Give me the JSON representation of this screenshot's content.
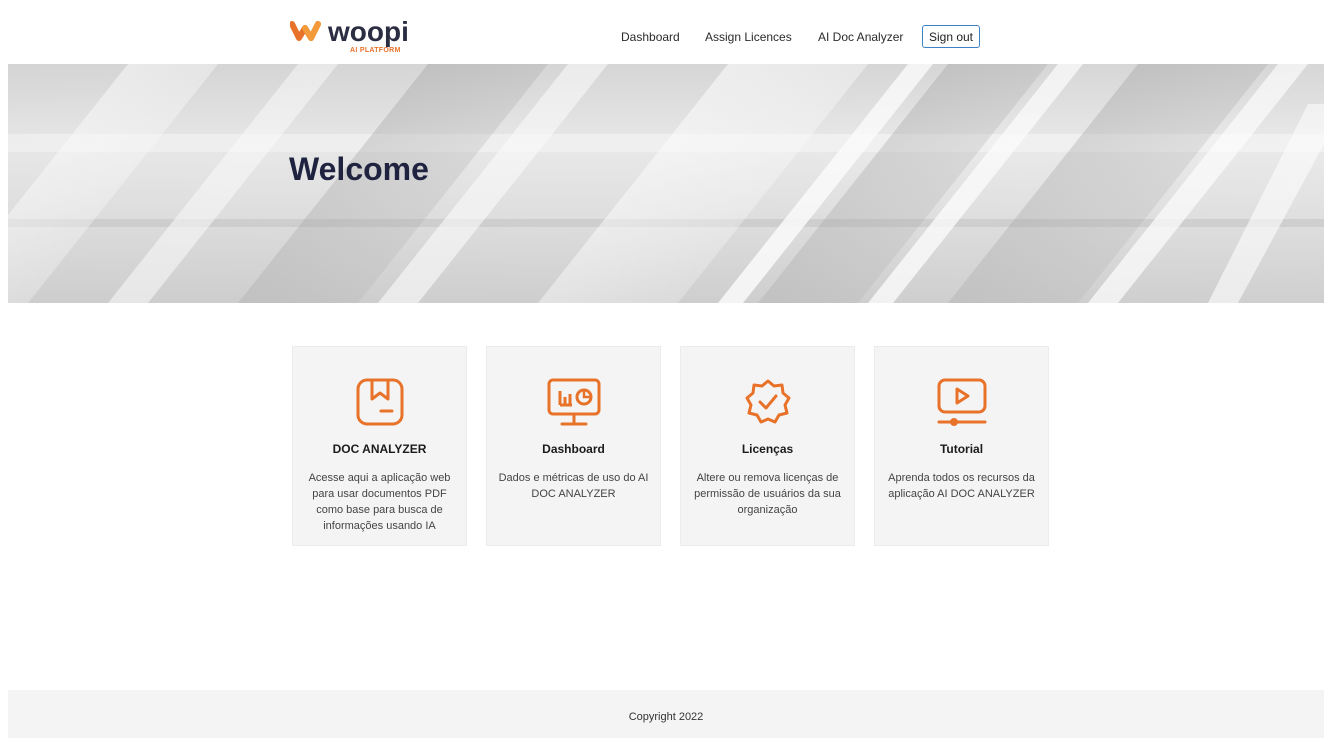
{
  "brand": {
    "name": "woopi",
    "tagline": "AI PLATFORM",
    "primary_color": "#e8722a",
    "text_color": "#2b2d42"
  },
  "nav": {
    "links": [
      "Dashboard",
      "Assign Licences",
      "AI Doc Analyzer"
    ],
    "signout_label": "Sign out"
  },
  "hero": {
    "title": "Welcome"
  },
  "cards": [
    {
      "icon": "bookmark-document-icon",
      "title": "DOC ANALYZER",
      "description": "Acesse aqui a aplicação web para usar documentos PDF como base para busca de informações usando IA"
    },
    {
      "icon": "monitor-chart-icon",
      "title": "Dashboard",
      "description": "Dados e métricas de uso do AI DOC ANALYZER"
    },
    {
      "icon": "verified-badge-icon",
      "title": "Licenças",
      "description": "Altere ou remova licenças de permissão de usuários da sua organização"
    },
    {
      "icon": "video-play-icon",
      "title": "Tutorial",
      "description": "Aprenda todos os recursos da aplicação AI DOC ANALYZER"
    }
  ],
  "footer": {
    "copyright": "Copyright 2022"
  }
}
